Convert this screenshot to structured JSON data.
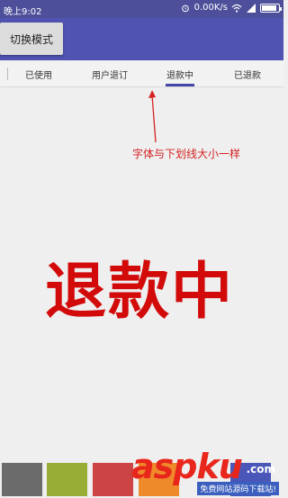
{
  "status_bar": {
    "time": "晚上9:02",
    "speed": "0.00K/s",
    "battery_level": 0.9,
    "icons": [
      "alarm-icon",
      "wifi-icon",
      "signal-icon",
      "battery-icon"
    ]
  },
  "toolbar": {
    "switch_label": "切换模式"
  },
  "tabs": [
    {
      "label": "已使用",
      "selected": false
    },
    {
      "label": "用户退订",
      "selected": false
    },
    {
      "label": "退款中",
      "selected": true
    },
    {
      "label": "已退款",
      "selected": false
    }
  ],
  "annotation": {
    "text": "字体与下划线大小一样"
  },
  "content": {
    "big_text": "退款中"
  },
  "swatches": [
    "#6b6b6b",
    "#97ad35",
    "#cc4444",
    "#ef8a2a",
    "#4a56b8"
  ],
  "watermark": {
    "logo": "aspku",
    "dotcom": ".com",
    "subtitle": "免费网站源码下载站!"
  },
  "colors": {
    "status_bar": "#4d4f9a",
    "toolbar": "#5053b1",
    "indicator": "#4347a8",
    "big_text": "#d20a0a",
    "annotation": "#d42222"
  }
}
